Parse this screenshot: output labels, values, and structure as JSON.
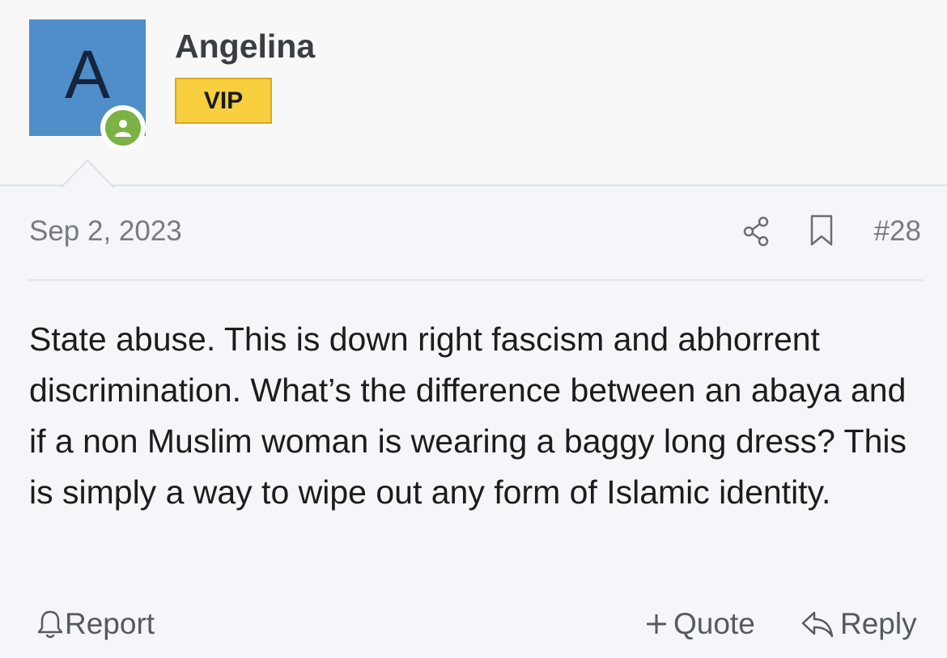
{
  "user": {
    "avatar_letter": "A",
    "name": "Angelina",
    "badge": "VIP",
    "online": true,
    "avatar_color": "#4f8ec9",
    "badge_color": "#f7cf3f",
    "online_color": "#7bb244"
  },
  "post": {
    "date": "Sep 2, 2023",
    "number": "#28",
    "body": "State abuse. This is down right fascism and abhorrent discrimination. What’s the difference between an abaya and if a non Muslim woman is wearing a baggy long dress? This is simply a way to wipe out any form of Islamic identity."
  },
  "actions": {
    "share_icon": "share-icon",
    "bookmark_icon": "bookmark-icon",
    "report_label": "Report",
    "quote_label": "Quote",
    "reply_label": "Reply"
  }
}
